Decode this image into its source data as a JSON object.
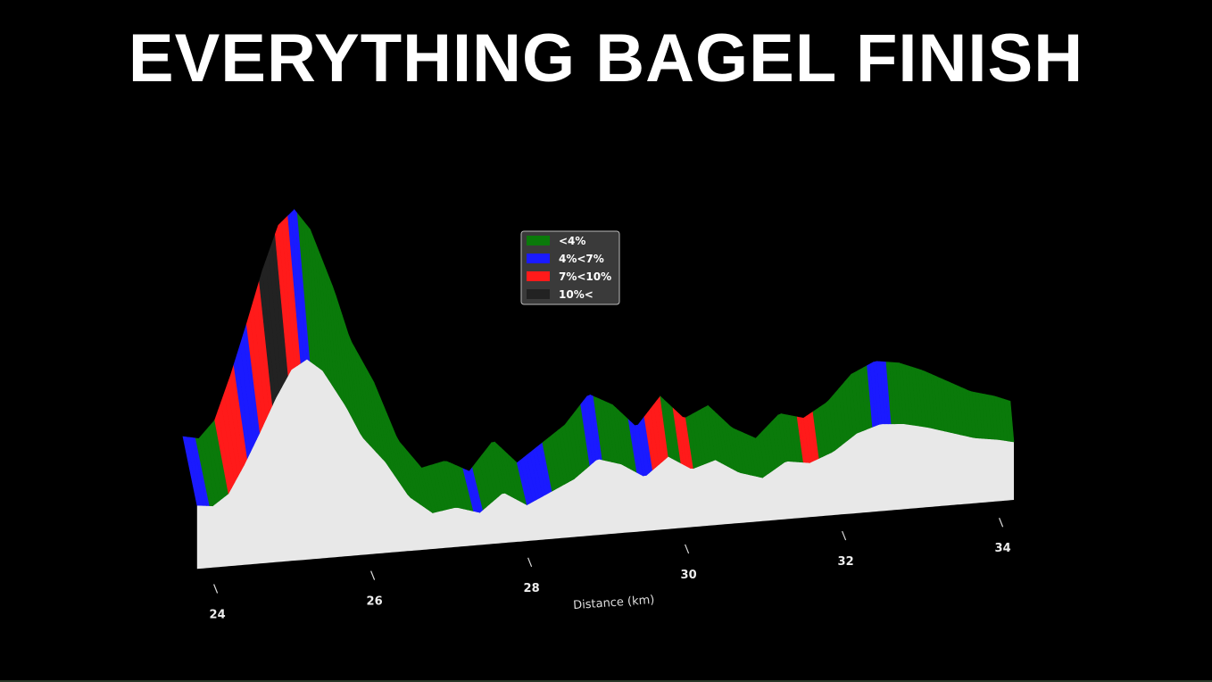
{
  "header": {
    "title": "EVERYTHING BAGEL FINISH"
  },
  "colors": {
    "background": "#000000",
    "grade_lt4": "#0a7a0a",
    "grade_4_7": "#1a1aff",
    "grade_7_10": "#ff1a1a",
    "grade_gt10": "#222222",
    "wall": "#e8e8e8"
  },
  "chart_data": {
    "type": "area",
    "style": "3d-perspective elevation profile",
    "xlabel": "Distance (km)",
    "ylabel": "",
    "xlim": [
      23.8,
      34.3
    ],
    "xticks": [
      24,
      26,
      28,
      30,
      32,
      34
    ],
    "xtick_labels": [
      "24",
      "26",
      "28",
      "30",
      "32",
      "34"
    ],
    "legend_position": "top-center",
    "legend": [
      {
        "label": "<4%",
        "color": "#0a7a0a"
      },
      {
        "label": "4%<7%",
        "color": "#1a1aff"
      },
      {
        "label": "7%<10%",
        "color": "#ff1a1a"
      },
      {
        "label": "10%<",
        "color": "#222222"
      }
    ],
    "elevation_profile": {
      "x": [
        23.9,
        24.1,
        24.3,
        24.5,
        24.7,
        24.9,
        25.1,
        25.3,
        25.5,
        25.6,
        25.8,
        26.0,
        26.3,
        26.6,
        26.9,
        27.2,
        27.5,
        27.8,
        28.1,
        28.4,
        28.7,
        29.0,
        29.3,
        29.6,
        29.9,
        30.2,
        30.5,
        30.8,
        31.1,
        31.4,
        31.7,
        32.0,
        32.3,
        32.6,
        32.9,
        33.2,
        33.5,
        33.8,
        34.1,
        34.3
      ],
      "y": [
        0.25,
        0.24,
        0.3,
        0.45,
        0.62,
        0.8,
        0.95,
        1.0,
        0.93,
        0.86,
        0.72,
        0.55,
        0.4,
        0.2,
        0.1,
        0.12,
        0.08,
        0.18,
        0.1,
        0.16,
        0.22,
        0.32,
        0.28,
        0.2,
        0.3,
        0.22,
        0.26,
        0.18,
        0.14,
        0.22,
        0.2,
        0.25,
        0.34,
        0.38,
        0.37,
        0.34,
        0.3,
        0.26,
        0.24,
        0.22
      ]
    },
    "grade_segments": [
      {
        "from": 23.9,
        "to": 24.05,
        "grade": "4%<7%"
      },
      {
        "from": 24.05,
        "to": 24.3,
        "grade": "<4%"
      },
      {
        "from": 24.3,
        "to": 24.55,
        "grade": "7%<10%"
      },
      {
        "from": 24.55,
        "to": 24.7,
        "grade": "4%<7%"
      },
      {
        "from": 24.7,
        "to": 24.85,
        "grade": "7%<10%"
      },
      {
        "from": 24.85,
        "to": 25.05,
        "grade": "10%<"
      },
      {
        "from": 25.05,
        "to": 25.2,
        "grade": "7%<10%"
      },
      {
        "from": 25.2,
        "to": 25.35,
        "grade": "4%<7%"
      },
      {
        "from": 25.35,
        "to": 25.6,
        "grade": "<4%"
      },
      {
        "from": 25.6,
        "to": 27.4,
        "grade": "<4%"
      },
      {
        "from": 27.4,
        "to": 27.55,
        "grade": "4%<7%"
      },
      {
        "from": 27.55,
        "to": 28.1,
        "grade": "<4%"
      },
      {
        "from": 28.1,
        "to": 28.4,
        "grade": "4%<7%"
      },
      {
        "from": 28.4,
        "to": 28.9,
        "grade": "<4%"
      },
      {
        "from": 28.9,
        "to": 29.05,
        "grade": "4%<7%"
      },
      {
        "from": 29.05,
        "to": 29.5,
        "grade": "<4%"
      },
      {
        "from": 29.5,
        "to": 29.7,
        "grade": "4%<7%"
      },
      {
        "from": 29.7,
        "to": 29.9,
        "grade": "7%<10%"
      },
      {
        "from": 29.9,
        "to": 30.05,
        "grade": "<4%"
      },
      {
        "from": 30.05,
        "to": 30.2,
        "grade": "7%<10%"
      },
      {
        "from": 30.2,
        "to": 31.6,
        "grade": "<4%"
      },
      {
        "from": 31.6,
        "to": 31.8,
        "grade": "7%<10%"
      },
      {
        "from": 31.8,
        "to": 32.5,
        "grade": "<4%"
      },
      {
        "from": 32.5,
        "to": 32.75,
        "grade": "4%<7%"
      },
      {
        "from": 32.75,
        "to": 34.3,
        "grade": "<4%"
      }
    ]
  }
}
